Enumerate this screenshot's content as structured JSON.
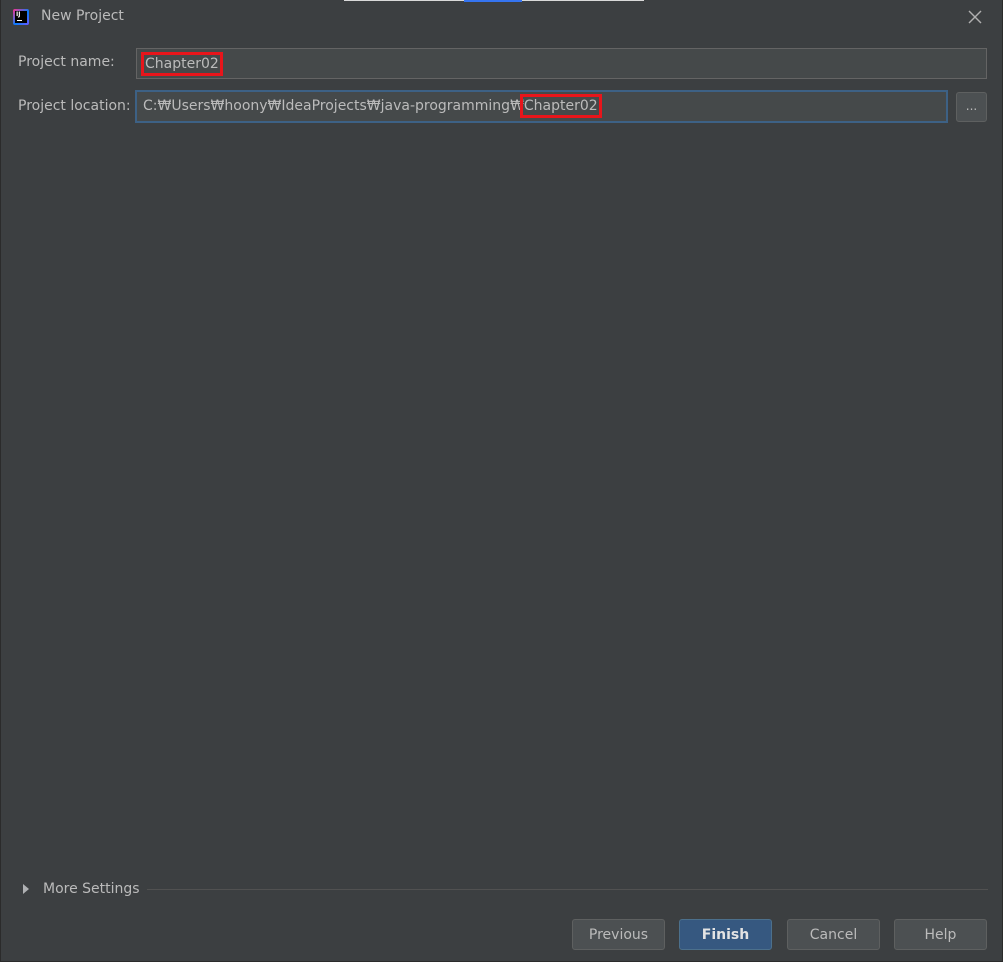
{
  "window": {
    "title": "New Project",
    "app_icon_text": "IJ"
  },
  "form": {
    "project_name_label": "Project name:",
    "project_name_value": "Chapter02",
    "project_location_label": "Project location:",
    "project_location_prefix": "C:₩Users₩hoony₩IdeaProjects₩java-programming₩",
    "project_location_highlight": "Chapter02",
    "browse_label": "..."
  },
  "more_settings": {
    "label": "More Settings"
  },
  "buttons": {
    "previous": "Previous",
    "finish": "Finish",
    "cancel": "Cancel",
    "help": "Help"
  },
  "colors": {
    "background": "#3c3f41",
    "field_bg": "#45494a",
    "focus_border": "#3d6185",
    "default_button": "#365880",
    "highlight_box": "#e8151b"
  }
}
